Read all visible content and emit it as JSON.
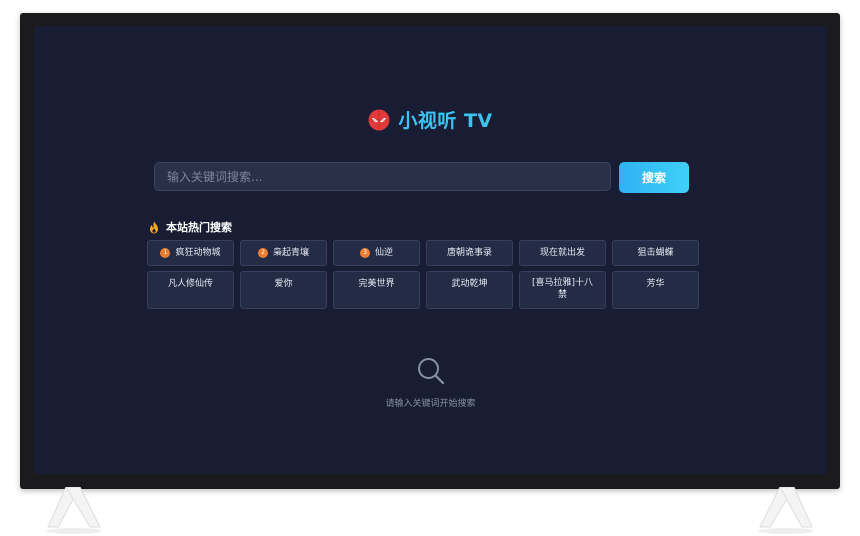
{
  "app": {
    "title": "小视听 TV"
  },
  "search": {
    "placeholder": "输入关键词搜索...",
    "value": "",
    "button_label": "搜索"
  },
  "hot": {
    "title": "本站热门搜索",
    "items": [
      {
        "rank": "1",
        "label": "疯狂动物城"
      },
      {
        "rank": "2",
        "label": "枭起青壤"
      },
      {
        "rank": "3",
        "label": "仙逆"
      },
      {
        "label": "唐朝诡事录"
      },
      {
        "label": "现在就出发"
      },
      {
        "label": "狙击蝴蝶"
      },
      {
        "label": "凡人修仙传"
      },
      {
        "label": "爱你"
      },
      {
        "label": "完美世界"
      },
      {
        "label": "武动乾坤"
      },
      {
        "label": "[喜马拉雅]十八禁"
      },
      {
        "label": "芳华"
      }
    ]
  },
  "empty_state": {
    "message": "请输入关键词开始搜索"
  },
  "colors": {
    "accent": "#3fc2f2",
    "screen_bg": "#181d33",
    "rank_badge": "#ef7d2f"
  },
  "icons": {
    "logo": "spider-mask-icon",
    "hot": "fire-icon",
    "empty": "search-icon"
  }
}
